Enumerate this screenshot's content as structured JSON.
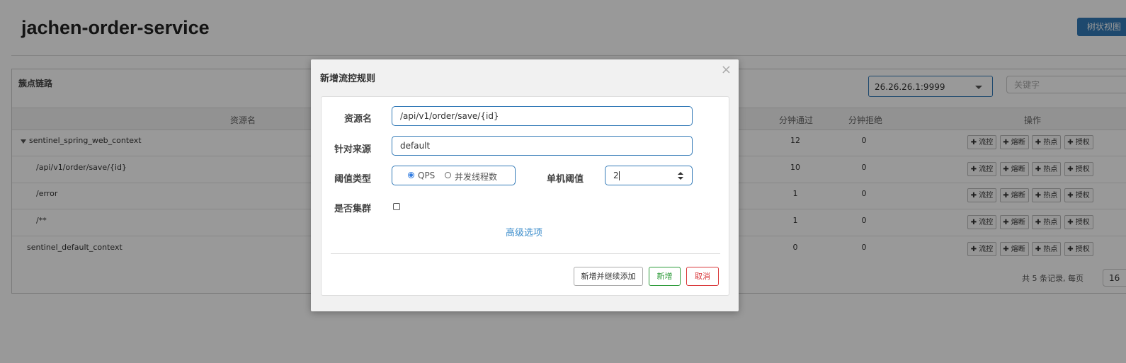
{
  "app": {
    "title": "jachen-order-service",
    "tree_view_label": "树状视图"
  },
  "panel": {
    "title": "簇点链路",
    "machine_select": "26.26.26.1:9999",
    "keyword_placeholder": "关键字"
  },
  "table": {
    "headers": {
      "resource": "资源名",
      "minute_pass": "分钟通过",
      "minute_block": "分钟拒绝",
      "actions": "操作"
    },
    "rows": [
      {
        "name": "sentinel_spring_web_context",
        "minute_pass": "12",
        "minute_block": "0"
      },
      {
        "name": "/api/v1/order/save/{id}",
        "minute_pass": "10",
        "minute_block": "0"
      },
      {
        "name": "/error",
        "minute_pass": "1",
        "minute_block": "0"
      },
      {
        "name": "/**",
        "minute_pass": "1",
        "minute_block": "0"
      },
      {
        "name": "sentinel_default_context",
        "minute_pass": "0",
        "minute_block": "0"
      }
    ],
    "row_actions": {
      "flow": "✚ 流控",
      "degrade": "✚ 熔断",
      "hotspot": "✚ 热点",
      "authority": "✚ 授权"
    }
  },
  "pager": {
    "summary": "共 5 条记录, 每页",
    "page_size": "16"
  },
  "modal": {
    "title": "新增流控规则",
    "close_icon": "×",
    "resource_label": "资源名",
    "resource_value": "/api/v1/order/save/{id}",
    "origin_label": "针对来源",
    "origin_value": "default",
    "threshold_type_label": "阈值类型",
    "threshold_options": [
      "QPS",
      "并发线程数"
    ],
    "threshold_selected": "QPS",
    "single_threshold_label": "单机阈值",
    "single_threshold_value": "2",
    "cluster_label": "是否集群",
    "cluster_checked": false,
    "advanced_link": "高级选项",
    "buttons": {
      "add_continue": "新增并继续添加",
      "add": "新增",
      "cancel": "取消"
    }
  },
  "colors": {
    "primary": "#337ab7",
    "success": "#2e9b3a",
    "danger": "#d9383a",
    "link": "#3c8dcb"
  }
}
